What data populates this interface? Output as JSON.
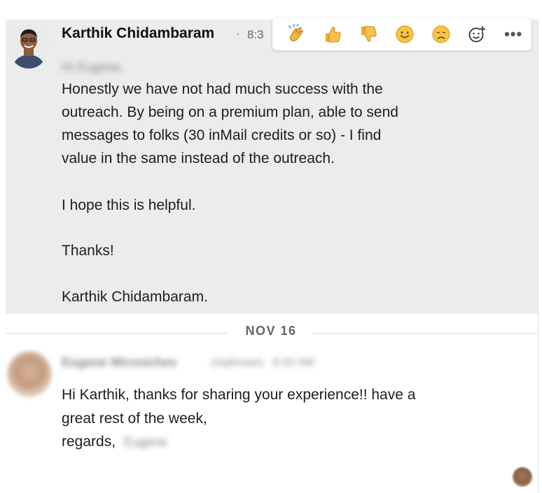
{
  "message1": {
    "sender": "Karthik Chidambaram",
    "separator": "·",
    "time": "8:3",
    "greeting": "Hi Eugene,",
    "lines": [
      "Honestly we have not had much success with the",
      "outreach. By being on a premium plan, able to send",
      "messages to folks (30 inMail credits or so) - I find",
      "value in the same instead of the outreach.",
      "I hope this is helpful.",
      "Thanks!",
      "Karthik Chidambaram."
    ]
  },
  "reactions": {
    "items": [
      "clap-icon",
      "thumbs-up-icon",
      "thumbs-down-icon",
      "smile-icon",
      "sad-icon",
      "add-emoji-icon"
    ],
    "more_label": "•••"
  },
  "date_divider": {
    "label": "NOV 16"
  },
  "message2": {
    "sender": "Eugene Mironichev",
    "meta": "(rephrase) · 8:42 AM",
    "lines": [
      "Hi Karthik, thanks for sharing your experience!! have a",
      "great rest of the week,"
    ],
    "regards": "regards,",
    "signoff": "Eugene"
  }
}
